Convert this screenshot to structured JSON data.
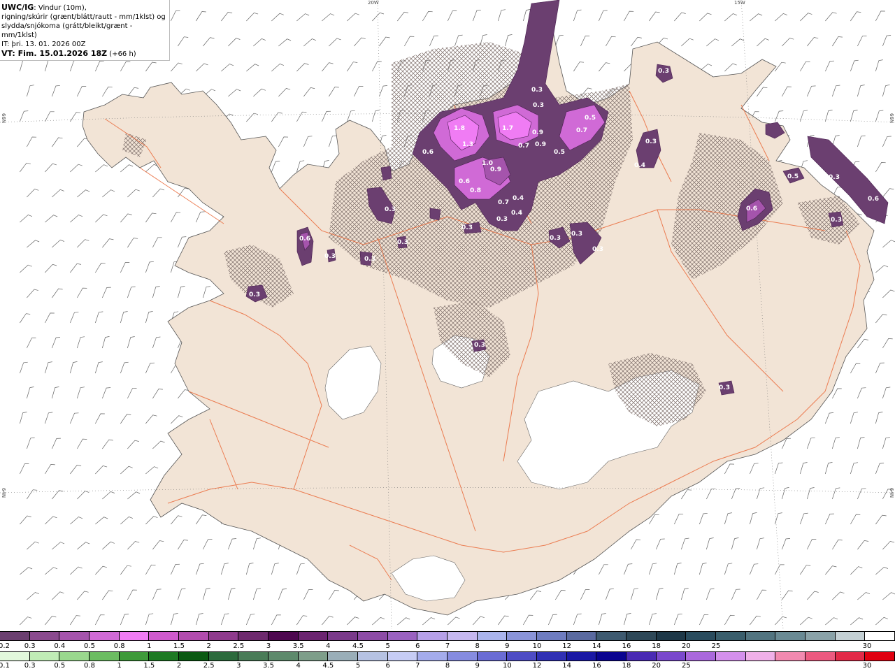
{
  "title": {
    "line1_bold": "UWC/IG",
    "line1_rest": ": Vindur (10m),",
    "line2": "rigning/skúrir (grænt/blátt/rautt - mm/1klst) og",
    "line3": "slydda/snjókoma (grátt/bleikt/grænt - mm/1klst)",
    "line4": "IT: þri. 13. 01. 2026 00Z",
    "line5_bold": "VT: Fim. 15.01.2026 18Z",
    "line5_rest": " (+66 h)"
  },
  "coords": {
    "top_20w": "20W",
    "top_15w": "15W",
    "left_66n": "66N",
    "left_64n": "64N",
    "right_66n": "66N",
    "right_64n": "64N"
  },
  "colors": {
    "land": "#f2e4d6",
    "road": "#ea6a3a",
    "sea": "#ffffff",
    "hatch": "#7a6a66"
  },
  "precip_labels": [
    "1.8",
    "1.7",
    "1.3",
    "1.0",
    "0.9",
    "0.9",
    "0.9",
    "0.8",
    "0.7",
    "0.7",
    "0.7",
    "0.6",
    "0.6",
    "0.6",
    "0.6",
    "0.5",
    "0.5",
    "0.4",
    "0.4",
    "0.4",
    "0.3",
    "0.3",
    "0.3",
    "0.3",
    "0.3",
    "0.3",
    "0.3",
    "0.3",
    "0.3",
    "0.3",
    "0.3",
    "0.3",
    "0.3",
    "0.3",
    "0.3",
    "0.3",
    "0.3",
    "0.6",
    "0.5",
    "0.3"
  ],
  "snow_scale": {
    "colors": [
      "#6b3f70",
      "#8a4a8e",
      "#a554ac",
      "#d06ad6",
      "#f07cf4",
      "#cf5acd",
      "#b24cae",
      "#8f3b8d",
      "#6e2a6e",
      "#4e0850",
      "#6b2470",
      "#7a3a8a",
      "#8d4ca6",
      "#9a62c0",
      "#b6a0e8",
      "#c6b8f0",
      "#aab4ec",
      "#8a94d8",
      "#6e7cc0",
      "#5a6aa0",
      "#3e5a70",
      "#2e4858",
      "#1e3848",
      "#2a4c5e",
      "#3a5e6c",
      "#527480",
      "#6a8a94",
      "#8aa2a8",
      "#c4d0d4",
      "#ffffff"
    ],
    "ticks": [
      "0.2",
      "0.3",
      "0.4",
      "0.5",
      "0.8",
      "1",
      "1.5",
      "2",
      "2.5",
      "3",
      "3.5",
      "4",
      "4.5",
      "5",
      "6",
      "7",
      "8",
      "9",
      "10",
      "12",
      "14",
      "16",
      "18",
      "20",
      "25",
      "30"
    ]
  },
  "rain_scale": {
    "colors": [
      "#e2f8dc",
      "#c0ecb6",
      "#9ad88e",
      "#6cbc62",
      "#3e9a3a",
      "#1e7a24",
      "#0a5a12",
      "#2c6a3c",
      "#4a7c58",
      "#5e8a6c",
      "#7e9e8a",
      "#9aaeb8",
      "#b6c2e2",
      "#c6ccf4",
      "#a4acec",
      "#868ce0",
      "#6a6cd4",
      "#4e4cc4",
      "#3030b4",
      "#1a18a4",
      "#0a0490",
      "#4a2ab4",
      "#7a48cc",
      "#aa68dc",
      "#d490ec",
      "#f0b0e8",
      "#f28ab0",
      "#ec5a80",
      "#e22a48",
      "#e00010"
    ],
    "ticks": [
      "0.1",
      "0.3",
      "0.5",
      "0.8",
      "1",
      "1.5",
      "2",
      "2.5",
      "3",
      "3.5",
      "4",
      "4.5",
      "5",
      "6",
      "7",
      "8",
      "9",
      "10",
      "12",
      "14",
      "16",
      "18",
      "20",
      "25",
      "30"
    ]
  }
}
